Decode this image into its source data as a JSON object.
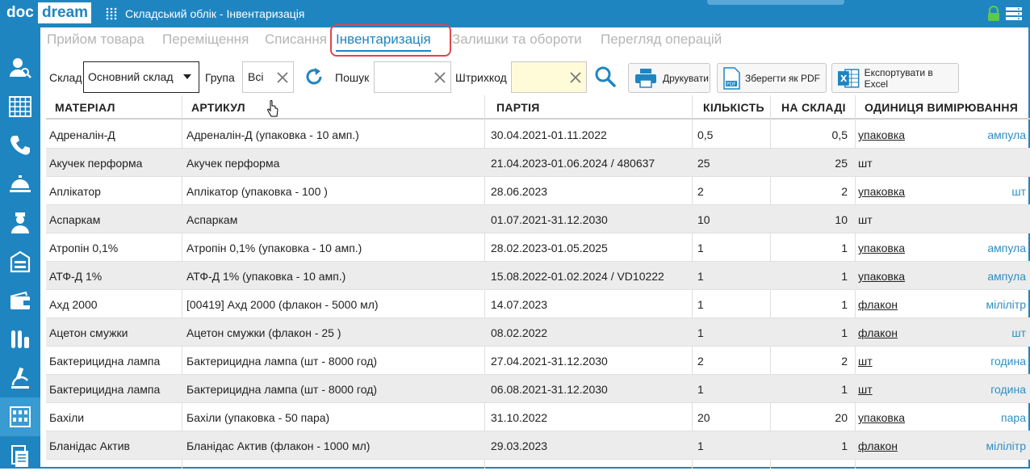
{
  "app": {
    "logo_doc": "doc",
    "logo_dream": "dream",
    "window_title": "Складський облік - Інвентаризація",
    "accent_color": "#1f85c1",
    "highlight_color": "#e0454a"
  },
  "sidebar": {
    "items": [
      {
        "icon": "user-search-icon"
      },
      {
        "icon": "calendar-grid-icon"
      },
      {
        "icon": "phone-icon"
      },
      {
        "icon": "service-bell-icon"
      },
      {
        "icon": "doctor-icon"
      },
      {
        "icon": "medical-box-icon"
      },
      {
        "icon": "wallet-icon"
      },
      {
        "icon": "test-tubes-icon"
      },
      {
        "icon": "microscope-icon"
      },
      {
        "icon": "warehouse-icon",
        "active": true
      },
      {
        "icon": "report-icon"
      }
    ]
  },
  "tabs": [
    {
      "label": "Прийом товара"
    },
    {
      "label": "Переміщення"
    },
    {
      "label": "Списання"
    },
    {
      "label": "Інвентаризація",
      "active": true
    },
    {
      "label": "Залишки та обороти"
    },
    {
      "label": "Перегляд операцій"
    }
  ],
  "toolbar": {
    "warehouse_label": "Склад",
    "warehouse_value": "Основний склад",
    "group_label": "Група",
    "group_value": "Всі",
    "search_label": "Пошук",
    "search_value": "",
    "barcode_label": "Штрихкод",
    "barcode_value": "",
    "print_label": "Друкувати",
    "pdf_label": "Зберегти як PDF",
    "excel_label": "Експортувати в Excel"
  },
  "table": {
    "columns": [
      "МАТЕРІАЛ",
      "АРТИКУЛ",
      "ПАРТІЯ",
      "КІЛЬКІСТЬ",
      "НА СКЛАДІ",
      "ОДИНИЦЯ ВИМІРЮВАННЯ"
    ],
    "rows": [
      {
        "material": "Адреналін-Д",
        "article": "Адреналін-Д (упаковка - 10 амп.)",
        "batch": "30.04.2021-01.11.2022",
        "qty": "0,5",
        "stock": "0,5",
        "unit": "упаковка",
        "subunit": "ампула"
      },
      {
        "material": "Акучек перформа",
        "article": "Акучек перформа",
        "batch": "21.04.2023-01.06.2024 / 480637",
        "qty": "25",
        "stock": "25",
        "unit": "шт",
        "subunit": ""
      },
      {
        "material": "Аплікатор",
        "article": "Аплікатор (упаковка - 100 )",
        "batch": "28.06.2023",
        "qty": "2",
        "stock": "2",
        "unit": "упаковка",
        "subunit": "шт"
      },
      {
        "material": "Аспаркам",
        "article": "Аспаркам",
        "batch": "01.07.2021-31.12.2030",
        "qty": "10",
        "stock": "10",
        "unit": "шт",
        "subunit": ""
      },
      {
        "material": "Атропін 0,1%",
        "article": "Атропін 0,1% (упаковка - 10 амп.)",
        "batch": "28.02.2023-01.05.2025",
        "qty": "1",
        "stock": "1",
        "unit": "упаковка",
        "subunit": "ампула"
      },
      {
        "material": "АТФ-Д 1%",
        "article": "АТФ-Д 1% (упаковка - 10 амп.)",
        "batch": "15.08.2022-01.02.2024 / VD10222",
        "qty": "1",
        "stock": "1",
        "unit": "упаковка",
        "subunit": "ампула"
      },
      {
        "material": "Ахд 2000",
        "article": "[00419] Ахд 2000 (флакон - 5000 мл)",
        "batch": "14.07.2023",
        "qty": "1",
        "stock": "1",
        "unit": "флакон",
        "subunit": "мілілітр"
      },
      {
        "material": "Ацетон смужки",
        "article": "Ацетон смужки (флакон - 25 )",
        "batch": "08.02.2022",
        "qty": "1",
        "stock": "1",
        "unit": "флакон",
        "subunit": "шт"
      },
      {
        "material": "Бактерицидна лампа",
        "article": "Бактерицидна лампа (шт - 8000 год)",
        "batch": "27.04.2021-31.12.2030",
        "qty": "2",
        "stock": "2",
        "unit": "шт",
        "subunit": "година"
      },
      {
        "material": "Бактерицидна лампа",
        "article": "Бактерицидна лампа (шт - 8000 год)",
        "batch": "06.08.2021-31.12.2030",
        "qty": "1",
        "stock": "1",
        "unit": "шт",
        "subunit": "година"
      },
      {
        "material": "Бахіли",
        "article": "Бахіли (упаковка - 50 пара)",
        "batch": "31.10.2022",
        "qty": "20",
        "stock": "20",
        "unit": "упаковка",
        "subunit": "пара"
      },
      {
        "material": "Бланідас Актив",
        "article": "Бланідас Актив (флакон - 1000 мл)",
        "batch": "29.03.2023",
        "qty": "1",
        "stock": "1",
        "unit": "флакон",
        "subunit": "мілілітр"
      }
    ]
  }
}
